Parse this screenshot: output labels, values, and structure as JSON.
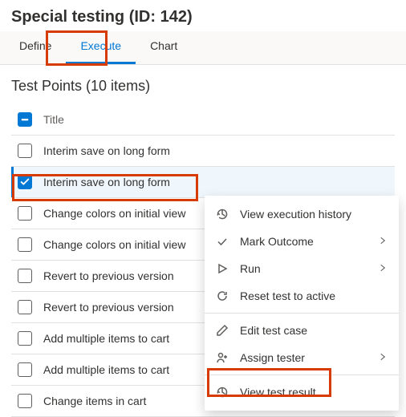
{
  "header": {
    "title": "Special testing (ID: 142)"
  },
  "tabs": {
    "items": [
      {
        "label": "Define"
      },
      {
        "label": "Execute"
      },
      {
        "label": "Chart"
      }
    ],
    "activeIndex": 1
  },
  "list": {
    "title": "Test Points (10 items)",
    "columnHeader": "Title",
    "rows": [
      {
        "title": "Interim save on long form",
        "checked": false
      },
      {
        "title": "Interim save on long form",
        "checked": true
      },
      {
        "title": "Change colors on initial view",
        "checked": false
      },
      {
        "title": "Change colors on initial view",
        "checked": false
      },
      {
        "title": "Revert to previous version",
        "checked": false
      },
      {
        "title": "Revert to previous version",
        "checked": false
      },
      {
        "title": "Add multiple items to cart",
        "checked": false
      },
      {
        "title": "Add multiple items to cart",
        "checked": false
      },
      {
        "title": "Change items in cart",
        "checked": false
      }
    ]
  },
  "contextMenu": {
    "items": [
      {
        "icon": "history-icon",
        "label": "View execution history",
        "submenu": false
      },
      {
        "icon": "check-icon",
        "label": "Mark Outcome",
        "submenu": true
      },
      {
        "icon": "play-icon",
        "label": "Run",
        "submenu": true
      },
      {
        "icon": "reset-icon",
        "label": "Reset test to active",
        "submenu": false
      },
      {
        "divider": true
      },
      {
        "icon": "edit-icon",
        "label": "Edit test case",
        "submenu": false
      },
      {
        "icon": "assign-icon",
        "label": "Assign tester",
        "submenu": true
      },
      {
        "divider": true
      },
      {
        "icon": "history-icon",
        "label": "View test result",
        "submenu": false
      }
    ]
  }
}
